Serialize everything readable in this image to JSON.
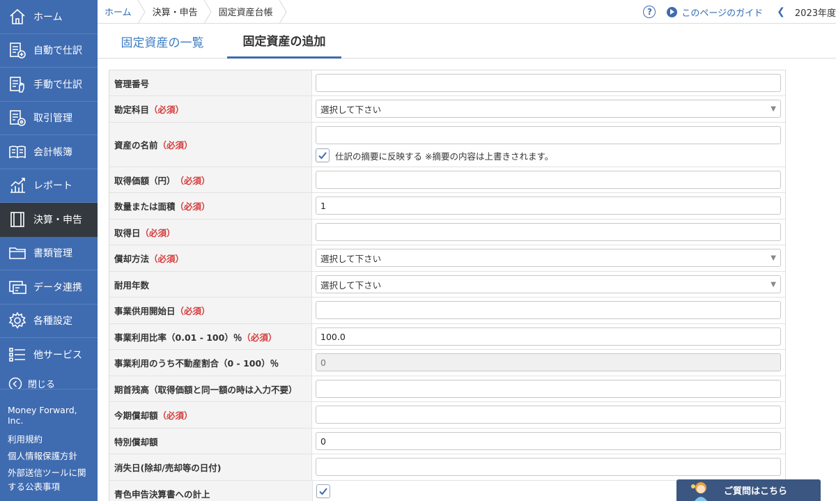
{
  "sidebar": {
    "items": [
      {
        "label": "ホーム",
        "icon": "home-icon"
      },
      {
        "label": "自動で仕訳",
        "icon": "auto-journal-icon"
      },
      {
        "label": "手動で仕訳",
        "icon": "manual-journal-icon"
      },
      {
        "label": "取引管理",
        "icon": "transaction-icon"
      },
      {
        "label": "会計帳簿",
        "icon": "ledger-book-icon"
      },
      {
        "label": "レポート",
        "icon": "report-chart-icon"
      },
      {
        "label": "決算・申告",
        "icon": "settlement-icon"
      },
      {
        "label": "書類管理",
        "icon": "folder-icon"
      },
      {
        "label": "データ連携",
        "icon": "data-link-icon"
      },
      {
        "label": "各種設定",
        "icon": "gear-icon"
      },
      {
        "label": "他サービス",
        "icon": "list-icon"
      }
    ],
    "close_label": "閉じる",
    "footer": {
      "company": "Money Forward, Inc.",
      "links": [
        "利用規約",
        "個人情報保護方針",
        "外部送信ツールに関する公表事項"
      ]
    }
  },
  "breadcrumb": [
    "ホーム",
    "決算・申告",
    "固定資産台帳"
  ],
  "topright": {
    "help_symbol": "?",
    "guide_label": "このページのガイド",
    "year_label": "2023年度"
  },
  "tabs": [
    "固定資産の一覧",
    "固定資産の追加"
  ],
  "form": {
    "required_mark": "（必須）",
    "fields": {
      "management_no": {
        "label": "管理番号",
        "value": ""
      },
      "account": {
        "label": "勘定科目",
        "value": "選択して下さい"
      },
      "asset_name": {
        "label": "資産の名前",
        "value": "",
        "checkbox_label": "仕訳の摘要に反映する ※摘要の内容は上書きされます。"
      },
      "acquisition_price": {
        "label": "取得価額（円）",
        "value": ""
      },
      "quantity": {
        "label": "数量または面積",
        "value": "1"
      },
      "acquisition_date": {
        "label": "取得日",
        "value": ""
      },
      "depreciation_method": {
        "label": "償却方法",
        "value": "選択して下さい"
      },
      "useful_life": {
        "label": "耐用年数",
        "value": "選択して下さい"
      },
      "business_start_date": {
        "label": "事業供用開始日",
        "value": ""
      },
      "business_ratio": {
        "label": "事業利用比率（0.01 - 100）％",
        "value": "100.0"
      },
      "real_estate_ratio": {
        "label": "事業利用のうち不動産割合（0 - 100）％",
        "placeholder": "0"
      },
      "opening_balance": {
        "label": "期首残高（取得価額と同一額の時は入力不要）",
        "value": ""
      },
      "current_depreciation": {
        "label": "今期償却額",
        "value": ""
      },
      "special_depreciation": {
        "label": "特別償却額",
        "value": "0"
      },
      "disposal_date": {
        "label": "消失日(除却/売却等の日付)",
        "value": ""
      },
      "blue_return": {
        "label": "青色申告決算書への計上"
      }
    }
  },
  "help_button": {
    "label": "ご質問はこちら"
  },
  "colors": {
    "sidebar": "#3f6bb0",
    "active": "#33393f",
    "required": "#d53c3c",
    "link": "#2e6db4"
  }
}
